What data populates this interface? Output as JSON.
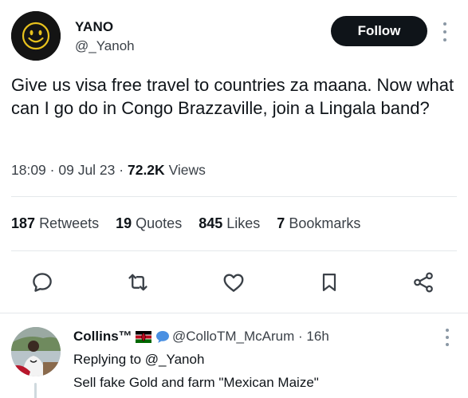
{
  "tweet": {
    "author_name": "YANO",
    "author_handle": "@_Yanoh",
    "follow_label": "Follow",
    "text": "Give us visa free travel to countries za maana. Now what can I go do in Congo Brazzaville, join a Lingala band?",
    "time": "18:09",
    "date": "09 Jul 23",
    "views_count": "72.2K",
    "views_label": "Views",
    "separator": "·"
  },
  "stats": {
    "retweets_count": "187",
    "retweets_label": "Retweets",
    "quotes_count": "19",
    "quotes_label": "Quotes",
    "likes_count": "845",
    "likes_label": "Likes",
    "bookmarks_count": "7",
    "bookmarks_label": "Bookmarks"
  },
  "actions": [
    "reply-icon",
    "retweet-icon",
    "like-icon",
    "bookmark-icon",
    "share-icon"
  ],
  "reply": {
    "name": "Collins™",
    "handle": "@ColloTM_McArum",
    "time": "16h",
    "replying_to_prefix": "Replying to",
    "replying_to_handle": "@_Yanoh",
    "text": "Sell fake Gold and farm \"Mexican Maize\"",
    "badges": [
      "kenya-flag-icon",
      "speech-bubble-icon"
    ]
  },
  "colors": {
    "text_primary": "#0f1419",
    "text_secondary": "#3b4148",
    "divider": "#e4e8eb",
    "button_bg": "#0f1419",
    "smiley_yellow": "#e8c21d"
  }
}
